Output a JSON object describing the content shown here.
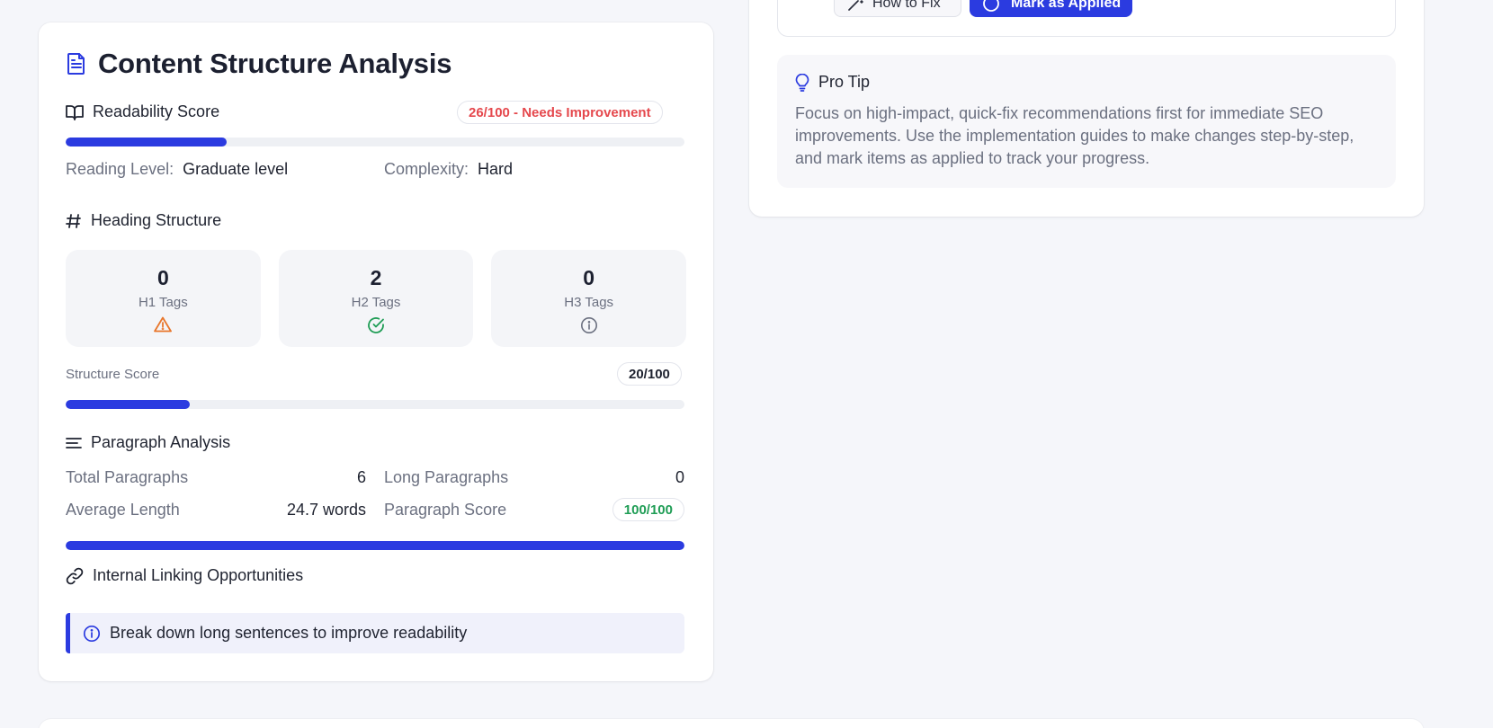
{
  "colors": {
    "accent": "#2b3be0",
    "danger": "#e5484d",
    "success": "#1f9d55",
    "warning": "#e8762b",
    "muted": "#6b7080"
  },
  "content_analysis": {
    "title": "Content Structure Analysis",
    "readability": {
      "heading": "Readability Score",
      "badge": "26/100 - Needs Improvement",
      "score": 26,
      "reading_level_label": "Reading Level:",
      "reading_level_value": "Graduate level",
      "complexity_label": "Complexity:",
      "complexity_value": "Hard"
    },
    "headings": {
      "heading": "Heading Structure",
      "tiles": [
        {
          "count": "0",
          "label": "H1 Tags",
          "icon": "warning-icon"
        },
        {
          "count": "2",
          "label": "H2 Tags",
          "icon": "check-circle-icon"
        },
        {
          "count": "0",
          "label": "H3 Tags",
          "icon": "info-icon"
        }
      ],
      "structure_label": "Structure Score",
      "structure_badge": "20/100",
      "structure_score": 20
    },
    "paragraphs": {
      "heading": "Paragraph Analysis",
      "total_label": "Total Paragraphs",
      "total_value": "6",
      "long_label": "Long Paragraphs",
      "long_value": "0",
      "avg_label": "Average Length",
      "avg_value": "24.7 words",
      "score_label": "Paragraph Score",
      "score_badge": "100/100",
      "score": 100
    },
    "linking": {
      "heading": "Internal Linking Opportunities",
      "message": "Break down long sentences to improve readability"
    }
  },
  "recommendation_actions": {
    "how_to_fix": "How to Fix",
    "mark_applied": "Mark as Applied"
  },
  "pro_tip": {
    "heading": "Pro Tip",
    "body": "Focus on high-impact, quick-fix recommendations first for immediate SEO improvements. Use the implementation guides to make changes step-by-step, and mark items as applied to track your progress."
  }
}
